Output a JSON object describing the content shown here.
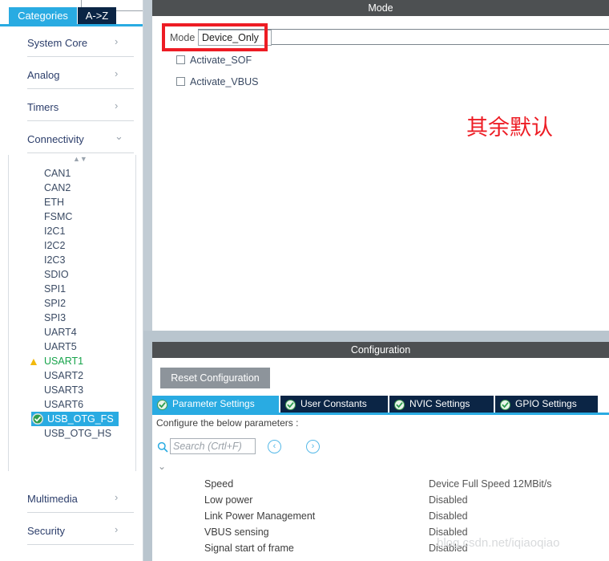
{
  "left_panel": {
    "top_search": {
      "value": ""
    },
    "tabs": [
      {
        "label": "Categories",
        "active": true
      },
      {
        "label": "A->Z",
        "active": false
      }
    ],
    "categories": [
      {
        "label": "System Core",
        "chevron": "chevron-right-icon"
      },
      {
        "label": "Analog",
        "chevron": "chevron-right-icon"
      },
      {
        "label": "Timers",
        "chevron": "chevron-right-icon"
      },
      {
        "label": "Connectivity",
        "chevron": "chevron-down-icon"
      }
    ],
    "peripherals": [
      {
        "label": "CAN1"
      },
      {
        "label": "CAN2"
      },
      {
        "label": "ETH"
      },
      {
        "label": "FSMC"
      },
      {
        "label": "I2C1"
      },
      {
        "label": "I2C2"
      },
      {
        "label": "I2C3"
      },
      {
        "label": "SDIO"
      },
      {
        "label": "SPI1"
      },
      {
        "label": "SPI2"
      },
      {
        "label": "SPI3"
      },
      {
        "label": "UART4"
      },
      {
        "label": "UART5"
      },
      {
        "label": "USART1",
        "state": "warning"
      },
      {
        "label": "USART2"
      },
      {
        "label": "USART3"
      },
      {
        "label": "USART6"
      },
      {
        "label": "USB_OTG_FS",
        "state": "selected"
      },
      {
        "label": "USB_OTG_HS"
      }
    ],
    "categories_bottom": [
      {
        "label": "Multimedia",
        "chevron": "chevron-right-icon"
      },
      {
        "label": "Security",
        "chevron": "chevron-right-icon"
      }
    ]
  },
  "mode_panel": {
    "header": "Mode",
    "mode_label": "Mode",
    "mode_value": "Device_Only",
    "checkboxes": [
      {
        "label": "Activate_SOF",
        "checked": false
      },
      {
        "label": "Activate_VBUS",
        "checked": false
      }
    ],
    "annotation": "其余默认"
  },
  "config_panel": {
    "header": "Configuration",
    "reset_button": "Reset Configuration",
    "tabs": [
      {
        "label": "Parameter Settings",
        "active": true,
        "icon": "green-check-icon"
      },
      {
        "label": "User Constants",
        "active": false,
        "icon": "green-check-icon"
      },
      {
        "label": "NVIC Settings",
        "active": false,
        "icon": "green-check-icon"
      },
      {
        "label": "GPIO Settings",
        "active": false,
        "icon": "green-check-icon"
      }
    ],
    "configure_note": "Configure the below parameters :",
    "search": {
      "value": "",
      "placeholder": "Search (Crtl+F)"
    },
    "nav_prev": "‹",
    "nav_next": "›",
    "parameters": [
      {
        "name": "Speed",
        "value": "Device Full Speed 12MBit/s"
      },
      {
        "name": "Low power",
        "value": "Disabled"
      },
      {
        "name": "Link Power Management",
        "value": "Disabled"
      },
      {
        "name": "VBUS sensing",
        "value": "Disabled"
      },
      {
        "name": "Signal start of frame",
        "value": "Disabled"
      }
    ]
  },
  "watermark": "blog.csdn.net/iqiaoqiao",
  "colors": {
    "accent": "#29abe2",
    "tab_dark": "#0b2545",
    "panel_header": "#4d5052",
    "splitter": "#b9c5ce",
    "annotation_red": "#ed1c24",
    "warning_yellow": "#f2b90c",
    "check_green": "#16a34a"
  }
}
